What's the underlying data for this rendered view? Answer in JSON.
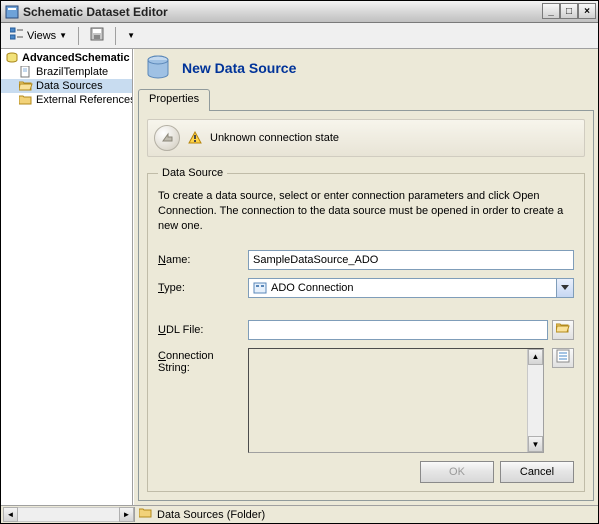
{
  "window": {
    "title": "Schematic Dataset Editor"
  },
  "toolbar": {
    "views_label": "Views",
    "icons": [
      "tree-icon",
      "save-icon",
      "dropdown-icon"
    ]
  },
  "tree": {
    "root": "AdvancedSchematic",
    "items": [
      {
        "label": "BrazilTemplate",
        "icon": "doc-icon",
        "selected": false
      },
      {
        "label": "Data Sources",
        "icon": "folder-icon",
        "selected": true
      },
      {
        "label": "External References",
        "icon": "folder-icon",
        "selected": false
      }
    ]
  },
  "header": {
    "title": "New Data Source"
  },
  "tabs": {
    "properties": "Properties"
  },
  "status": {
    "message": "Unknown connection state"
  },
  "datasource": {
    "legend": "Data Source",
    "info": "To create a data source, select or enter connection parameters and click Open Connection.  The connection to the data source must be opened in order to create a new one.",
    "name_label": "Name:",
    "name_value": "SampleDataSource_ADO",
    "type_label": "Type:",
    "type_value": "ADO Connection",
    "udl_label": "UDL File:",
    "udl_value": "",
    "conn_label": "Connection String:",
    "conn_value": ""
  },
  "buttons": {
    "ok": "OK",
    "cancel": "Cancel"
  },
  "statusbar": {
    "text": "Data Sources (Folder)"
  }
}
